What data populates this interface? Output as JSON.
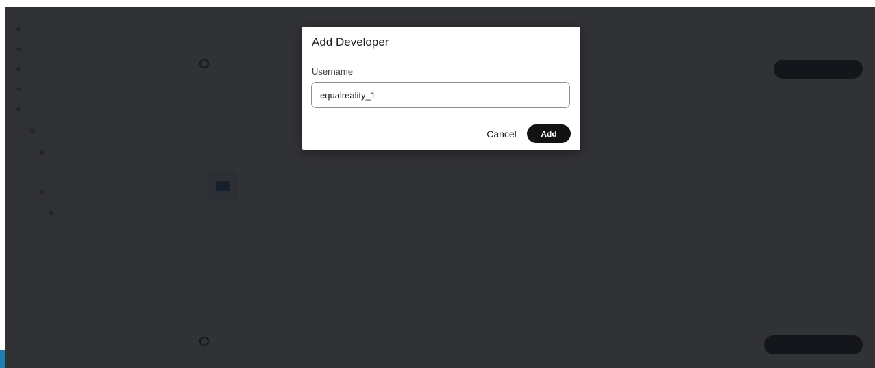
{
  "modal": {
    "title": "Add Developer",
    "field_label": "Username",
    "username_value": "equalreality_1",
    "cancel_label": "Cancel",
    "add_label": "Add"
  },
  "colors": {
    "overlay": "#14161a",
    "primary_button": "#111214",
    "accent": "#1f7fb3"
  }
}
